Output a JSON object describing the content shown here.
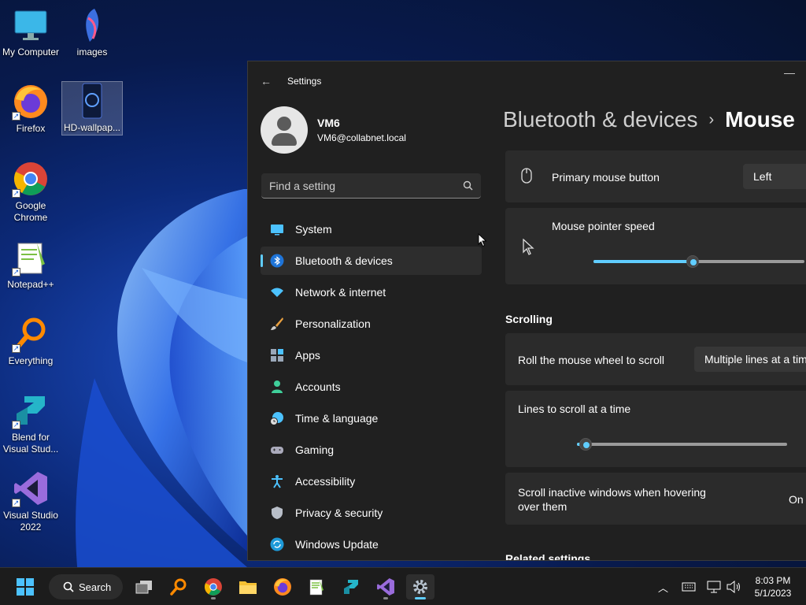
{
  "desktop": {
    "icons": [
      {
        "label": "My Computer"
      },
      {
        "label": "images"
      },
      {
        "label": "Firefox"
      },
      {
        "label": "HD-wallpap..."
      },
      {
        "label": "Google Chrome"
      },
      {
        "label": "Notepad++"
      },
      {
        "label": "Everything"
      },
      {
        "label": "Blend for Visual Stud..."
      },
      {
        "label": "Visual Studio 2022"
      }
    ]
  },
  "settings": {
    "title": "Settings",
    "user": {
      "name": "VM6",
      "email": "VM6@collabnet.local"
    },
    "search_placeholder": "Find a setting",
    "nav": [
      {
        "label": "System"
      },
      {
        "label": "Bluetooth & devices"
      },
      {
        "label": "Network & internet"
      },
      {
        "label": "Personalization"
      },
      {
        "label": "Apps"
      },
      {
        "label": "Accounts"
      },
      {
        "label": "Time & language"
      },
      {
        "label": "Gaming"
      },
      {
        "label": "Accessibility"
      },
      {
        "label": "Privacy & security"
      },
      {
        "label": "Windows Update"
      }
    ],
    "active_nav": "Bluetooth & devices",
    "breadcrumb": {
      "parent": "Bluetooth & devices",
      "separator": "›",
      "current": "Mouse"
    },
    "primary_button": {
      "label": "Primary mouse button",
      "value": "Left"
    },
    "pointer_speed": {
      "label": "Mouse pointer speed",
      "level": 0.47
    },
    "scrolling_header": "Scrolling",
    "roll_wheel": {
      "label": "Roll the mouse wheel to scroll",
      "value": "Multiple lines at a tim"
    },
    "lines_to_scroll": {
      "label": "Lines to scroll at a time",
      "level": 0.04
    },
    "scroll_inactive": {
      "label": "Scroll inactive windows when hovering over them",
      "value": "On"
    },
    "related_header": "Related settings"
  },
  "taskbar": {
    "search_label": "Search",
    "time": "8:03 PM",
    "date": "5/1/2023"
  },
  "colors": {
    "accent": "#60cdff",
    "window_bg": "#202020",
    "card_bg": "#2b2b2b"
  }
}
